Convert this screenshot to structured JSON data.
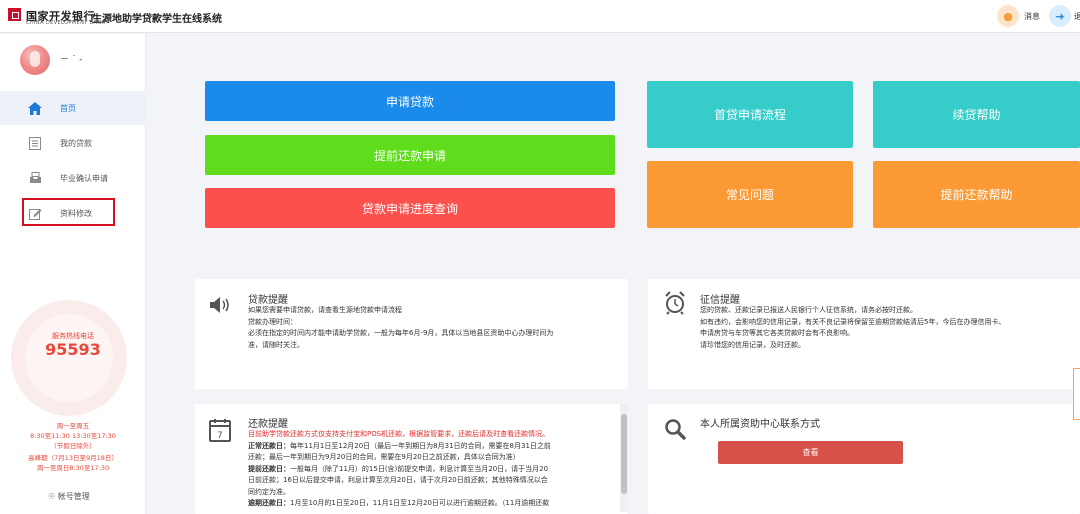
{
  "header": {
    "bank_name": "国家开发银行",
    "bank_name_en": "CHINA DEVELOPMENT BANK",
    "system_title": "生源地助学贷款学生在线系统",
    "messages_label": "消息",
    "exit_label": "退"
  },
  "sidebar": {
    "user_name": "－ ˙ ‐",
    "items": [
      {
        "label": "首页",
        "icon": "home-icon"
      },
      {
        "label": "我的贷款",
        "icon": "document-icon"
      },
      {
        "label": "毕业确认申请",
        "icon": "tray-icon"
      },
      {
        "label": "资料修改",
        "icon": "edit-icon"
      }
    ],
    "service": {
      "label": "服务热线电话",
      "phone": "95593",
      "hours": [
        "周一至周五",
        "8:30至11:30 13:30至17:30",
        "（节假日除外）",
        "高峰期（7月13日至9月18日）",
        "周一至周日8:30至17:30"
      ]
    },
    "account_mgmt": "帐号管理"
  },
  "actions": {
    "apply_loan": "申请贷款",
    "early_repay_apply": "提前还款申请",
    "progress_query": "贷款申请进度查询",
    "first_loan_flow": "首贷申请流程",
    "renew_help": "续贷帮助",
    "faq": "常见问题",
    "early_repay_help": "提前还款帮助"
  },
  "colors": {
    "blue": "#1a8bea",
    "green": "#5fdc1c",
    "red": "#fb504b",
    "teal": "#36ccc9",
    "orange": "#fb9a34"
  },
  "loan_reminder": {
    "title": "贷款提醒",
    "lines": [
      "如果您需要申请贷款，请查看生源地贷款申请流程",
      "贷款办理时间：",
      "必须在指定的时间内才能申请助学贷款，一般为每年6月-9月，具体以当地县区资助中心办理时间为",
      "准，请随时关注。"
    ]
  },
  "credit_reminder": {
    "title": "征信提醒",
    "lines": [
      "您的贷款、还款记录已报送人民银行个人征信系统，请务必按时还款。",
      "如有违约，会影响您的信用记录，有关不良记录将保留至逾期贷款结清后5年，今后在办理信用卡、",
      "申请房贷与车贷等其它各类贷款时会有不良影响。",
      "请珍惜您的信用记录，及时还款。"
    ]
  },
  "repay_reminder": {
    "title": "还款提醒",
    "notice": "目前助学贷款还款方式仅支持支付宝和POS机还款，根据监管要求，还款后请及时查看还款情况。",
    "normal_label": "正常还款日：",
    "normal_text_1": "每年11月1日至12月20日（最后一年到期日为8月31日的合同，需要在8月31日之前",
    "normal_text_2": "还款；最后一年到期日为9月20日的合同，需要在9月20日之前还款，具体以合同为准）",
    "early_label": "提前还款日：",
    "early_text_1": "一般每月（除了11月）的15日(含)前提交申请，利息计算至当月20日，请于当月20",
    "early_text_2": "日前还款；16日以后提交申请，利息计算至次月20日，请于次月20日前还款；其他特殊情况以合",
    "early_text_3": "同约定为准。",
    "overdue_label": "逾期还款日：",
    "overdue_text": "1月至10月的1日至20日，11月1日至12月20日可以进行逾期还款。（11月逾期还款"
  },
  "contact": {
    "title": "本人所属资助中心联系方式",
    "view_label": "查看"
  }
}
